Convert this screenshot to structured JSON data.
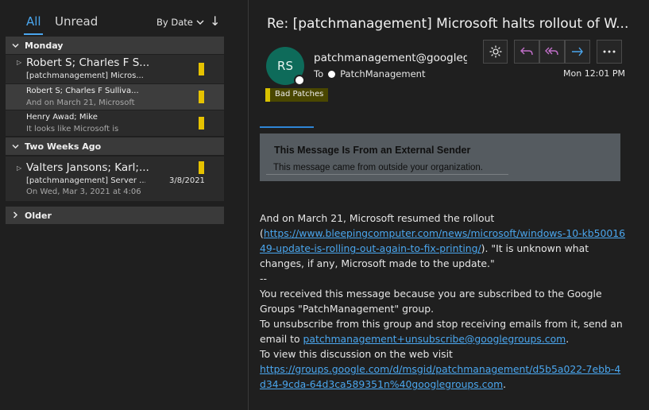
{
  "tabs": {
    "all": "All",
    "unread": "Unread"
  },
  "sort": {
    "label": "By Date",
    "direction_glyph": "↓"
  },
  "groups": {
    "monday": "Monday",
    "two_weeks_ago": "Two Weeks Ago",
    "older": "Older"
  },
  "messages": [
    {
      "from": "Robert S;  Charles F S...",
      "subject": "[patchmanagement] Micros...",
      "preview": "",
      "flag_color": "#e6c200"
    },
    {
      "from": "Robert S;  Charles F Sulliva...",
      "subject": "",
      "preview": "And on March 21, Microsoft",
      "flag_color": "#e6c200"
    },
    {
      "from": "Henry Awad;  Mike",
      "subject": "",
      "preview": "It looks like Microsoft is",
      "flag_color": "#e6c200"
    },
    {
      "from": "Valters Jansons;  Karl;...",
      "subject": "[patchmanagement] Server ...",
      "preview": "On Wed, Mar 3, 2021 at 4:06",
      "date": "3/8/2021",
      "flag_color": "#e6c200"
    }
  ],
  "reading": {
    "subject": "Re: [patchmanagement] Microsoft halts rollout of W...",
    "avatar_initials": "RS",
    "avatar_color": "#0e6b5a",
    "sender": "patchmanagement@googleg",
    "to_label": "To",
    "to_value": "PatchManagement",
    "category": "Bad Patches",
    "category_color": "#d8c100",
    "timestamp": "Mon 12:01 PM",
    "banner_title": "This Message Is From an External Sender",
    "banner_text": "This message came from outside your organization.",
    "body": {
      "l1": "And on March 21, Microsoft resumed the rollout",
      "l2_open": "(",
      "link1": "https://www.bleepingcomputer.com/news/microsoft/windows-10-kb5001649-update-is-rolling-out-again-to-fix-printing/",
      "l2_close": "). \"It is unknown what changes, if any, Microsoft made to the update.\"",
      "sep": "--",
      "l3": "You received this message because you are subscribed to the Google Groups \"PatchManagement\" group.",
      "l4": "To unsubscribe from this group and stop receiving emails from it, send an email to ",
      "link2": "patchmanagement+unsubscribe@googlegroups.com",
      "l4_end": ".",
      "l5": "To view this discussion on the web visit",
      "link3": "https://groups.google.com/d/msgid/patchmanagement/d5b5a022-7ebb-4d34-9cda-64d3ca589351n%40googlegroups.com",
      "l5_end": "."
    }
  },
  "accent_color": "#4aa6ee"
}
